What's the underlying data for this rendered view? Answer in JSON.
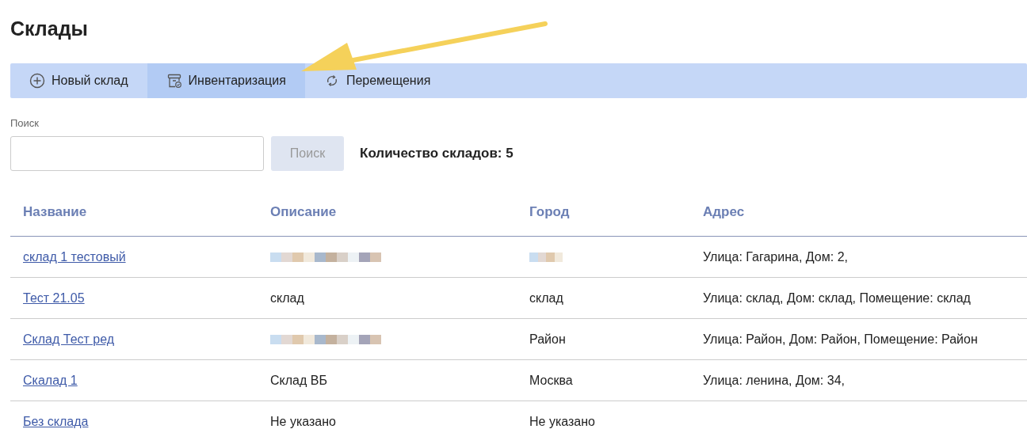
{
  "page_title": "Склады",
  "toolbar": [
    {
      "label": "Новый склад",
      "kind": "plus",
      "selected": false
    },
    {
      "label": "Инвентаризация",
      "kind": "inventory",
      "selected": true
    },
    {
      "label": "Перемещения",
      "kind": "sync",
      "selected": false
    }
  ],
  "annotation": {
    "kind": "arrow"
  },
  "search": {
    "label": "Поиск",
    "button": "Поиск",
    "disabled": true
  },
  "count": "Количество складов: 5",
  "table": {
    "columns": [
      "Название",
      "Описание",
      "Город",
      "Адрес"
    ],
    "rows": [
      {
        "name": "склад 1 тестовый",
        "description": {
          "redacted": true
        },
        "city": {
          "redacted": true
        },
        "address": "Улица: Гагарина, Дом: 2,"
      },
      {
        "name": "Тест 21.05",
        "description": {
          "text": "склад"
        },
        "city": {
          "text": "склад"
        },
        "address": "Улица: склад, Дом: склад, Помещение: склад"
      },
      {
        "name": "Склад Тест ред",
        "description": {
          "redacted": true
        },
        "city": {
          "text": "Район"
        },
        "address": "Улица: Район, Дом: Район, Помещение: Район"
      },
      {
        "name": "Скалад 1",
        "description": {
          "text": "Склад ВБ"
        },
        "city": {
          "text": "Москва"
        },
        "address": "Улица: ленина, Дом: 34,"
      },
      {
        "name": "Без склада",
        "description": {
          "text": "Не указано"
        },
        "city": {
          "text": "Не указано"
        }
      }
    ]
  }
}
